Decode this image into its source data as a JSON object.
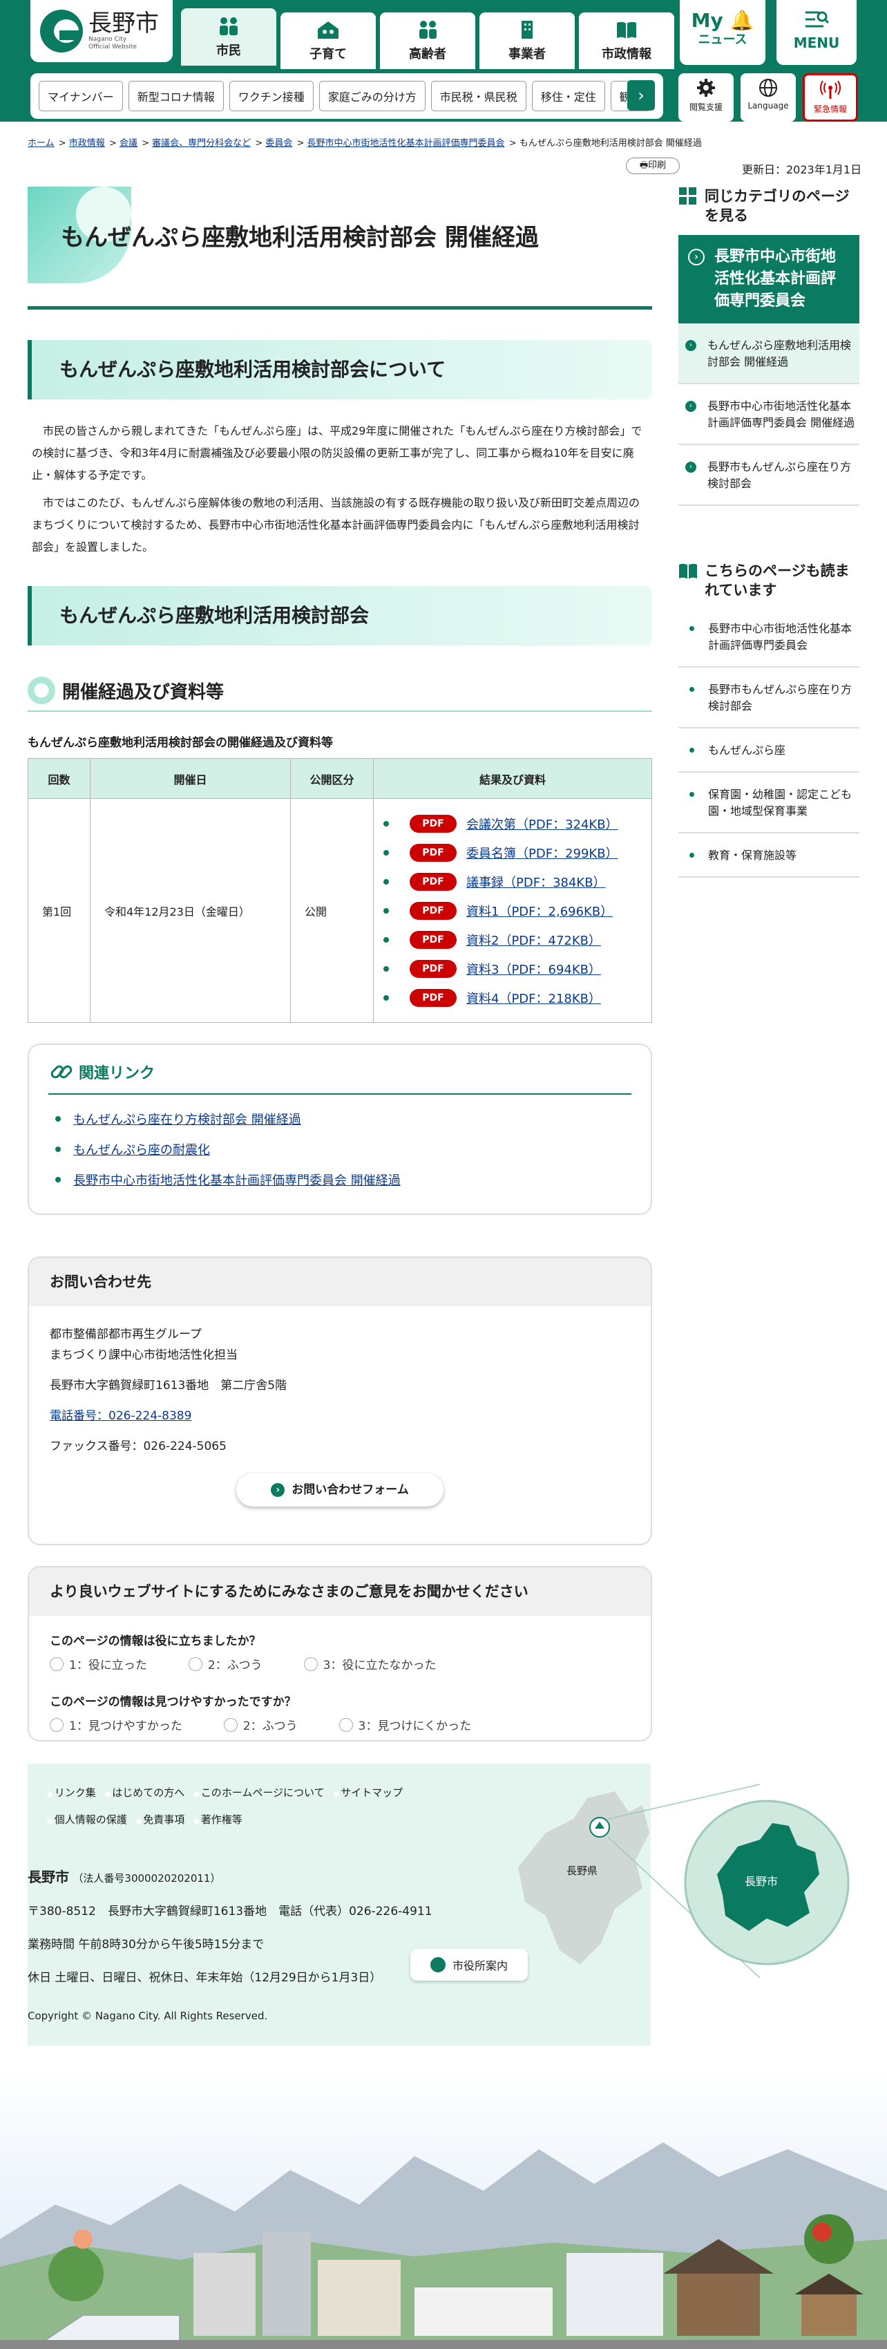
{
  "header": {
    "logo_jp": "長野市",
    "logo_en": "Nagano City Official Website",
    "tabs": [
      {
        "label": "市民",
        "active": true
      },
      {
        "label": "子育て"
      },
      {
        "label": "高齢者"
      },
      {
        "label": "事業者"
      },
      {
        "label": "市政情報"
      }
    ],
    "mynews_top": "My",
    "mynews_bottom": "ニュース",
    "menu": "MENU",
    "subnav": [
      "マイナンバー",
      "新型コロナ情報",
      "ワクチン接種",
      "家庭ごみの分け方",
      "市民税・県民税",
      "移住・定住",
      "観光"
    ],
    "tools": {
      "access": "閲覧支援",
      "language": "Language",
      "emergency": "緊急情報"
    }
  },
  "breadcrumb": [
    "ホーム",
    "市政情報",
    "会議",
    "審議会、専門分科会など",
    "委員会",
    "長野市中心市街地活性化基本計画評価専門委員会",
    "もんぜんぷら座敷地利活用検討部会 開催経過"
  ],
  "print": "印刷",
  "updated": "更新日：2023年1月1日",
  "page": {
    "title": "もんぜんぷら座敷地利活用検討部会 開催経過",
    "section1": "もんぜんぷら座敷地利活用検討部会について",
    "para1": "市民の皆さんから親しまれてきた「もんぜんぷら座」は、平成29年度に開催された「もんぜんぷら座在り方検討部会」での検討に基づき、令和3年4月に耐震補強及び必要最小限の防災設備の更新工事が完了し、同工事から概ね10年を目安に廃止・解体する予定です。",
    "para2": "市ではこのたび、もんぜんぷら座解体後の敷地の利活用、当該施設の有する既存機能の取り扱い及び新田町交差点周辺のまちづくりについて検討するため、長野市中心市街地活性化基本計画評価専門委員会内に「もんぜんぷら座敷地利活用検討部会」を設置しました。",
    "section2": "もんぜんぷら座敷地利活用検討部会",
    "h3": "開催経過及び資料等",
    "table_caption": "もんぜんぷら座敷地利活用検討部会の開催経過及び資料等",
    "table": {
      "headers": [
        "回数",
        "開催日",
        "公開区分",
        "結果及び資料"
      ],
      "rows": [
        {
          "no": "第1回",
          "date": "令和4年12月23日（金曜日）",
          "public": "公開",
          "files": [
            "会議次第（PDF：324KB）",
            "委員名簿（PDF：299KB）",
            "議事録（PDF：384KB）",
            "資料1（PDF：2,696KB）",
            "資料2（PDF：472KB）",
            "資料3（PDF：694KB）",
            "資料4（PDF：218KB）"
          ],
          "badge": "PDF"
        }
      ]
    },
    "related": {
      "title": "関連リンク",
      "links": [
        "もんぜんぷら座在り方検討部会 開催経過",
        "もんぜんぷら座の耐震化",
        "長野市中心市街地活性化基本計画評価専門委員会 開催経過"
      ]
    },
    "contact": {
      "title": "お問い合わせ先",
      "dept1": "都市整備部都市再生グループ",
      "dept2": "まちづくり課中心市街地活性化担当",
      "addr": "長野市大字鶴賀緑町1613番地　第二庁舎5階",
      "tel": "電話番号：026-224-8389",
      "fax": "ファックス番号：026-224-5065",
      "form": "お問い合わせフォーム"
    },
    "survey": {
      "title": "より良いウェブサイトにするためにみなさまのご意見をお聞かせください",
      "q1": "このページの情報は役に立ちましたか？",
      "q1_opts": [
        "1：役に立った",
        "2：ふつう",
        "3：役に立たなかった"
      ],
      "q2": "このページの情報は見つけやすかったですか？",
      "q2_opts": [
        "1：見つけやすかった",
        "2：ふつう",
        "3：見つけにくかった"
      ]
    }
  },
  "sidebar": {
    "same_cat": "同じカテゴリのページを見る",
    "current": "長野市中心市街地活性化基本計画評価専門委員会",
    "items": [
      "もんぜんぷら座敷地利活用検討部会 開催経過",
      "長野市中心市街地活性化基本計画評価専門委員会 開催経過",
      "長野市もんぜんぷら座在り方検討部会"
    ],
    "also_read": "こちらのページも読まれています",
    "also": [
      "長野市中心市街地活性化基本計画評価専門委員会",
      "長野市もんぜんぷら座在り方検討部会",
      "もんぜんぷら座",
      "保育園・幼稚園・認定こども園・地域型保育事業",
      "教育・保育施設等"
    ]
  },
  "footer": {
    "links1": [
      "リンク集",
      "はじめての方へ",
      "このホームページについて",
      "サイトマップ"
    ],
    "links2": [
      "個人情報の保護",
      "免責事項",
      "著作権等"
    ],
    "name": "長野市",
    "corp": "（法人番号3000020202011）",
    "addr": "〒380-8512　長野市大字鶴賀緑町1613番地　電話（代表）026-226-4911",
    "hours": "業務時間 午前8時30分から午後5時15分まで",
    "holidays": "休日 土曜日、日曜日、祝休日、年末年始（12月29日から1月3日）",
    "guide": "市役所案内",
    "pref": "長野県",
    "city": "長野市",
    "copyright": "Copyright © Nagano City. All Rights Reserved."
  },
  "colors": {
    "primary": "#0a7b60",
    "pdf": "#cc0000",
    "mint": "#e3f5ee"
  }
}
